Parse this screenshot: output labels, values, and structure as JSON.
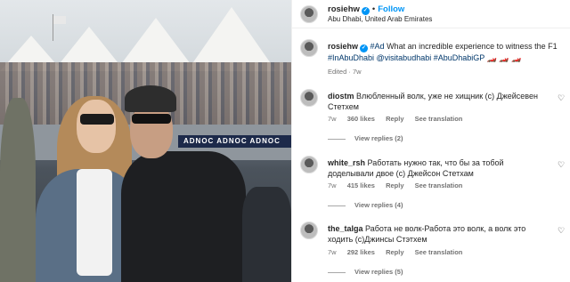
{
  "post": {
    "username": "rosiehw",
    "follow_label": "Follow",
    "location": "Abu Dhabi, United Arab Emirates",
    "caption_hashtag_ad": "#Ad",
    "caption_text": "What an incredible experience to witness the F1",
    "caption_tags": "#InAbuDhabi @visitabudhabi #AbuDhabiGP",
    "caption_flags": "🏎️ 🏎️ 🏎️",
    "edited_label": "Edited",
    "edited_age": "7w",
    "photo_banner": "ADNOC  ADNOC  ADNOC"
  },
  "comments": [
    {
      "username": "diostm",
      "text": "Влюбленный волк, уже не хищник (с) Джейсевен Стетхем",
      "age": "7w",
      "likes": "360 likes",
      "reply": "Reply",
      "see_translation": "See translation",
      "view_replies": "View replies (2)"
    },
    {
      "username": "white_rsh",
      "text": "Работать нужно так, что бы за тобой доделывали двое (с) Джейсон Стетхам",
      "age": "7w",
      "likes": "415 likes",
      "reply": "Reply",
      "see_translation": "See translation",
      "view_replies": "View replies (4)"
    },
    {
      "username": "the_talga",
      "text": "Работа не волк-Работа это волк, а волк это ходить (с)Джинсы Стэтхем",
      "age": "7w",
      "likes": "292 likes",
      "reply": "Reply",
      "see_translation": "See translation",
      "view_replies": "View replies (5)"
    }
  ],
  "icons": {
    "verified": "verified-badge-icon",
    "heart": "heart-icon"
  },
  "colors": {
    "accent": "#0095f6",
    "link": "#00376b",
    "muted": "#737373"
  }
}
